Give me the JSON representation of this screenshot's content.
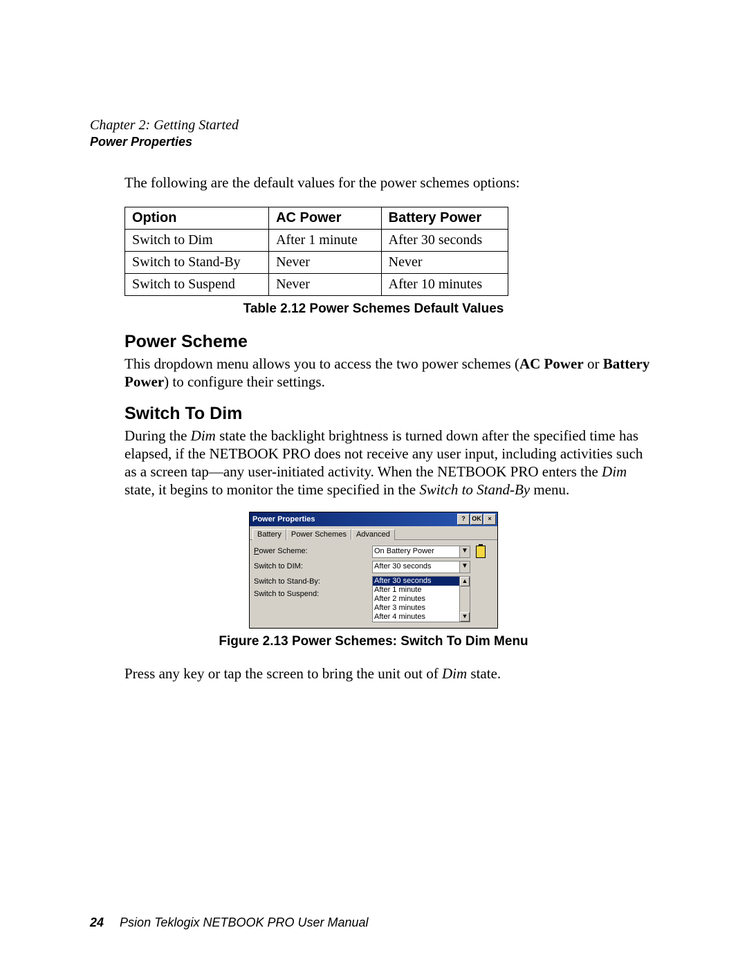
{
  "header": {
    "chapter": "Chapter 2:  Getting Started",
    "section": "Power Properties"
  },
  "intro": "The following are the default values for the power schemes options:",
  "table": {
    "headers": [
      "Option",
      "AC Power",
      "Battery Power"
    ],
    "rows": [
      [
        "Switch to Dim",
        "After 1 minute",
        "After 30 seconds"
      ],
      [
        "Switch to Stand-By",
        "Never",
        "Never"
      ],
      [
        "Switch to Suspend",
        "Never",
        "After 10 minutes"
      ]
    ],
    "caption": "Table 2.12 Power Schemes Default Values"
  },
  "sections": {
    "powerScheme": {
      "heading": "Power Scheme",
      "para_1": "This dropdown menu allows you to access the two power schemes (",
      "bold1": "AC Power",
      "mid": " or ",
      "bold2": "Battery Power",
      "para_2": ") to configure their settings."
    },
    "switchToDim": {
      "heading": "Switch To Dim",
      "para_a": "During the ",
      "ital1": "Dim",
      "para_b": " state the backlight brightness is turned down after the specified time has elapsed, if the NETBOOK PRO does not receive any user input, including activities such as a screen tap—any user-initiated activity. When the NETBOOK PRO enters the ",
      "ital2": "Dim",
      "para_c": " state, it begins to monitor the time specified in the ",
      "ital3": "Switch to Stand-By",
      "para_d": " menu."
    }
  },
  "dialog": {
    "title": "Power Properties",
    "btnHelp": "?",
    "btnOk": "OK",
    "btnClose": "×",
    "tabs": [
      "Battery",
      "Power Schemes",
      "Advanced"
    ],
    "labels": {
      "scheme": "Power Scheme:",
      "scheme_accel": "P",
      "dim": "Switch to DIM:",
      "standby": "Switch to Stand-By:",
      "suspend": "Switch to Suspend:"
    },
    "schemeValue": "On Battery Power",
    "dimValue": "After 30 seconds",
    "listItems": [
      "After 30 seconds",
      "After 1 minute",
      "After 2 minutes",
      "After 3 minutes",
      "After 4 minutes"
    ]
  },
  "figureCaption": "Figure 2.13 Power Schemes: Switch To Dim Menu",
  "press_a": "Press any key or tap the screen to bring the unit out of ",
  "press_i": "Dim",
  "press_b": " state.",
  "footer": {
    "page": "24",
    "title": "Psion Teklogix NETBOOK PRO User Manual"
  }
}
